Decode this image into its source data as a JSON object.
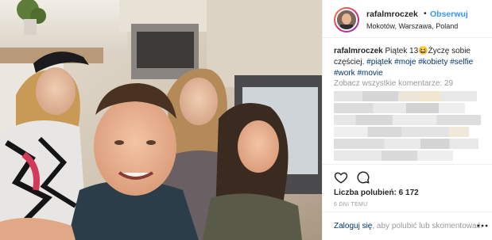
{
  "header": {
    "username": "rafalmroczek",
    "separator": "•",
    "follow_label": "Obserwuj",
    "location": "Mokotów, Warszawa, Poland"
  },
  "caption": {
    "username": "rafalmroczek",
    "text": "Piątek 13😆Życzę sobie częściej.",
    "hashtags": [
      "#piątek",
      "#moje",
      "#kobiety",
      "#selfie",
      "#work",
      "#movie"
    ]
  },
  "comments": {
    "see_all_label": "Zobacz wszystkie komentarze: 29"
  },
  "actions": {
    "like_icon": "heart-icon",
    "comment_icon": "comment-icon",
    "likes_label": "Liczba polubień:",
    "likes_count": "6 172",
    "time_ago": "6 DNI TEMU"
  },
  "login_bar": {
    "login_link": "Zaloguj się",
    "login_rest": ", aby polubić lub skomentować."
  },
  "colors": {
    "link_blue": "#3897f0",
    "hashtag_blue": "#003569",
    "muted_gray": "#999999",
    "border": "#efefef"
  }
}
